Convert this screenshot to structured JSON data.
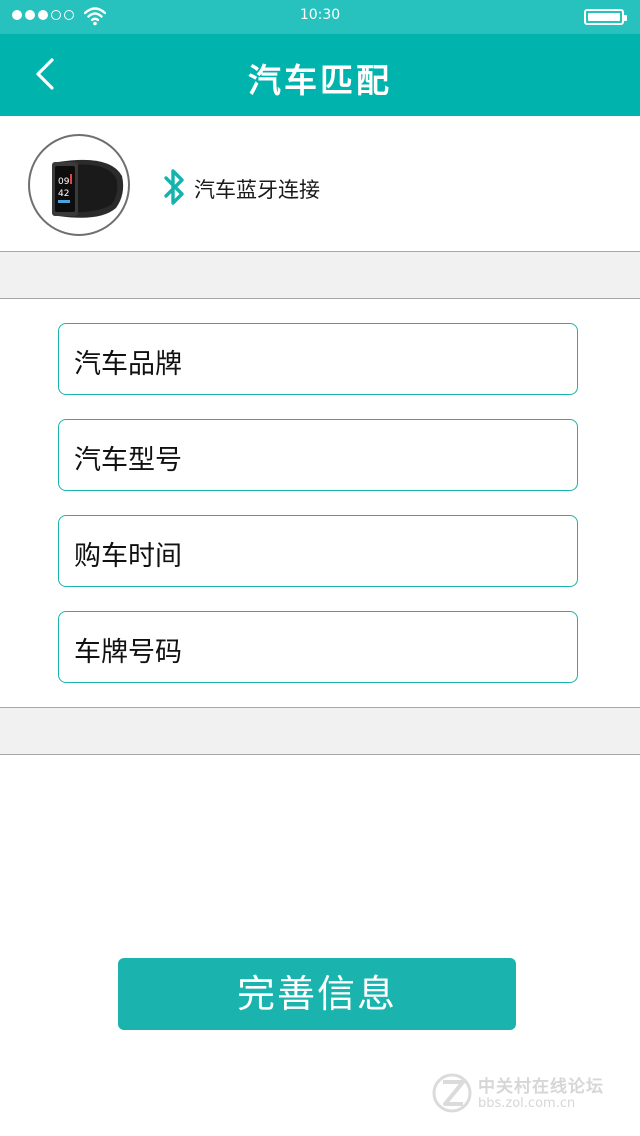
{
  "status_bar": {
    "time": "10:30"
  },
  "header": {
    "title": "汽车匹配"
  },
  "device": {
    "bluetooth_label": "汽车蓝牙连接",
    "watch_time_hour": "09",
    "watch_time_min": "42"
  },
  "form": {
    "fields": [
      {
        "label": "汽车品牌"
      },
      {
        "label": "汽车型号"
      },
      {
        "label": "购车时间"
      },
      {
        "label": "车牌号码"
      }
    ]
  },
  "actions": {
    "submit_label": "完善信息"
  },
  "watermark": {
    "name": "中关村在线论坛",
    "url": "bbs.zol.com.cn"
  },
  "colors": {
    "accent": "#00b3ad",
    "status_bar": "#27c2bd",
    "field_border": "#1ab3ad",
    "divider_bg": "#f1f1f1"
  }
}
